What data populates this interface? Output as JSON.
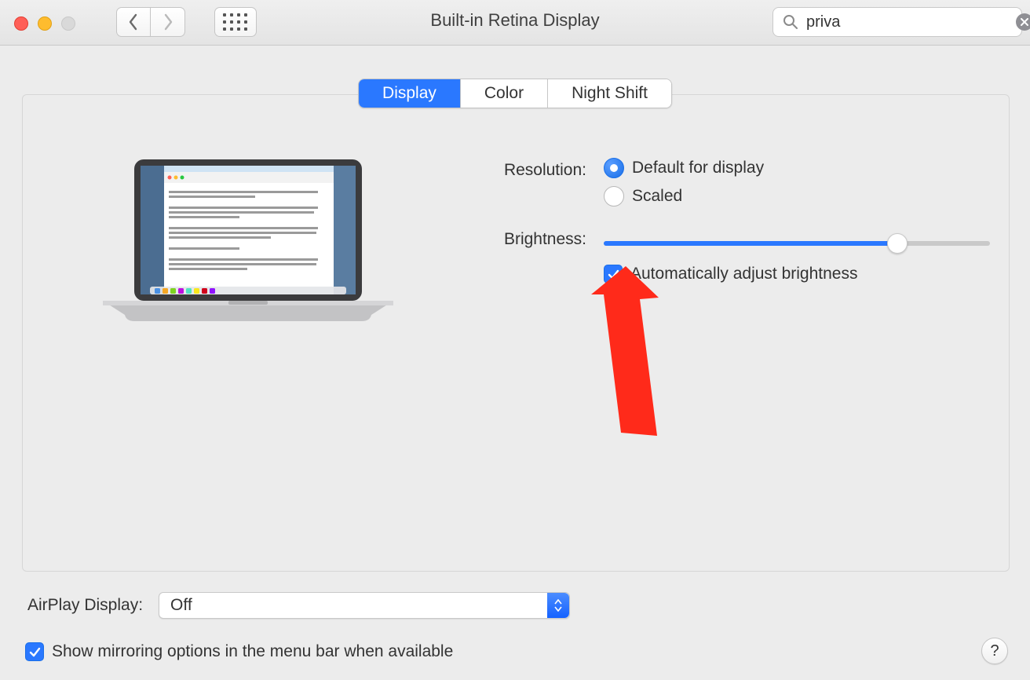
{
  "window_title": "Built-in Retina Display",
  "search": {
    "value": "priva"
  },
  "tabs": [
    {
      "label": "Display",
      "active": true
    },
    {
      "label": "Color",
      "active": false
    },
    {
      "label": "Night Shift",
      "active": false
    }
  ],
  "resolution": {
    "label": "Resolution:",
    "options": [
      {
        "label": "Default for display",
        "checked": true
      },
      {
        "label": "Scaled",
        "checked": false
      }
    ]
  },
  "brightness": {
    "label": "Brightness:",
    "value_pct": 76,
    "auto_label": "Automatically adjust brightness",
    "auto_checked": true
  },
  "airplay": {
    "label": "AirPlay Display:",
    "value": "Off"
  },
  "mirroring": {
    "checked": true,
    "label": "Show mirroring options in the menu bar when available"
  },
  "help_glyph": "?"
}
